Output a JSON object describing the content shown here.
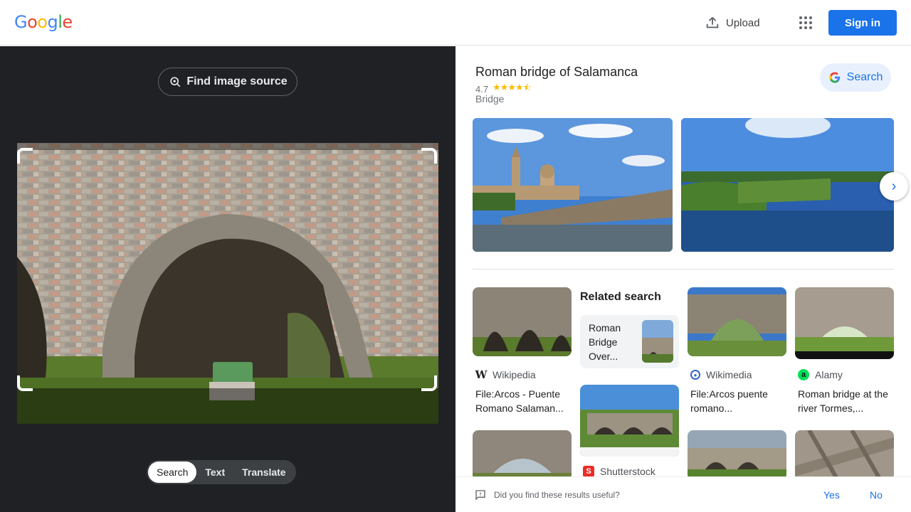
{
  "header": {
    "logo": [
      "G",
      "o",
      "o",
      "g",
      "l",
      "e"
    ],
    "logo_colors": [
      "#4285F4",
      "#EA4335",
      "#FBBC05",
      "#4285F4",
      "#34A853",
      "#EA4335"
    ],
    "upload_label": "Upload",
    "signin_label": "Sign in",
    "brand_blue": "#1a73e8"
  },
  "lens": {
    "find_source_label": "Find image source",
    "modes": [
      "Search",
      "Text",
      "Translate"
    ],
    "active_mode": "Search"
  },
  "knowledge_panel": {
    "title": "Roman bridge of Salamanca",
    "rating": "4.7",
    "stars_display": "★★★★⯪",
    "type": "Bridge",
    "search_chip_label": "Search"
  },
  "results": {
    "related_search_title": "Related search",
    "related_search_text": "Roman Bridge Over...",
    "items": [
      {
        "source": "Wikipedia",
        "source_icon": "wikipedia-icon",
        "caption": "File:Arcos - Puente Romano Salaman..."
      },
      {
        "source": "Wikimedia",
        "source_icon": "wikimedia-icon",
        "caption": "File:Arcos puente romano..."
      },
      {
        "source": "Alamy",
        "source_icon": "alamy-icon",
        "caption": "Roman bridge at the river Tormes,..."
      },
      {
        "source": "Shutterstock",
        "source_icon": "shutterstock-icon",
        "caption": ""
      }
    ]
  },
  "feedback": {
    "question": "Did you find these results useful?",
    "yes": "Yes",
    "no": "No"
  }
}
